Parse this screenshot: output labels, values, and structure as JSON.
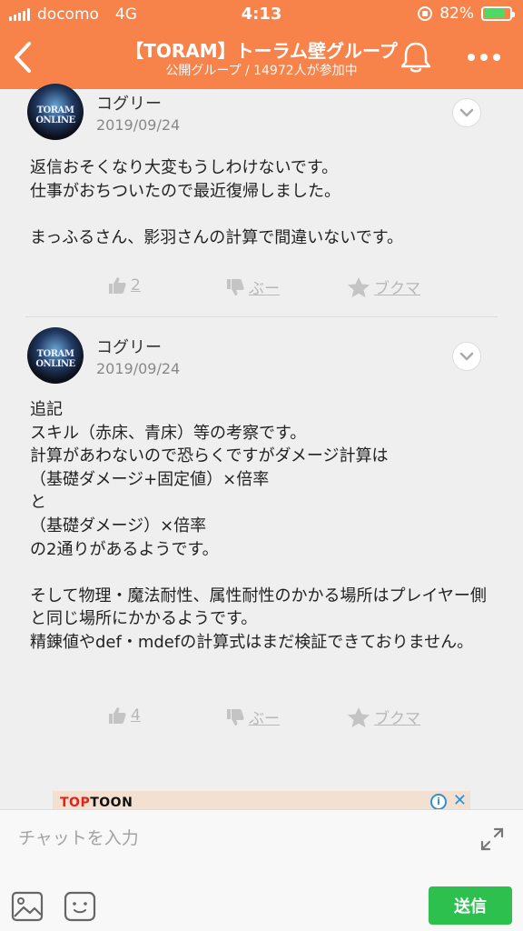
{
  "status_bar": {
    "carrier": "docomo",
    "network": "4G",
    "time": "4:13",
    "battery_percent": "82%",
    "battery_level": 0.82
  },
  "header": {
    "title": "【TORAM】トーラム壁グループ",
    "subtitle": "公開グループ / 14972人が参加中",
    "background_color": "#f7824a"
  },
  "posts": [
    {
      "avatar_text": "TORAM ONLINE",
      "author": "コグリー",
      "date": "2019/09/24",
      "body": "返信おそくなり大変もうしわけないです。\n仕事がおちついたので最近復帰しました。\n\nまっふるさん、影羽さんの計算で間違いないです。",
      "like_count": "2",
      "boo_label": "ぶー",
      "bookmark_label": "ブクマ"
    },
    {
      "avatar_text": "TORAM ONLINE",
      "author": "コグリー",
      "date": "2019/09/24",
      "body": "追記\nスキル（赤床、青床）等の考察です。\n計算があわないので恐らくですがダメージ計算は\n（基礎ダメージ+固定値）×倍率\nと\n（基礎ダメージ）×倍率\nの2通りがあるようです。\n\nそして物理・魔法耐性、属性耐性のかかる場所はプレイヤー側と同じ場所にかかるようです。\n精錬値やdef・mdefの計算式はまだ検証できておりません。",
      "like_count": "4",
      "boo_label": "ぶー",
      "bookmark_label": "ブクマ"
    }
  ],
  "ad": {
    "brand_prefix": "TOP",
    "brand_suffix": "TOON",
    "info_label": "i",
    "close_label": "✕"
  },
  "composer": {
    "placeholder": "チャットを入力",
    "send_label": "送信",
    "accent_color": "#2ec04f"
  }
}
